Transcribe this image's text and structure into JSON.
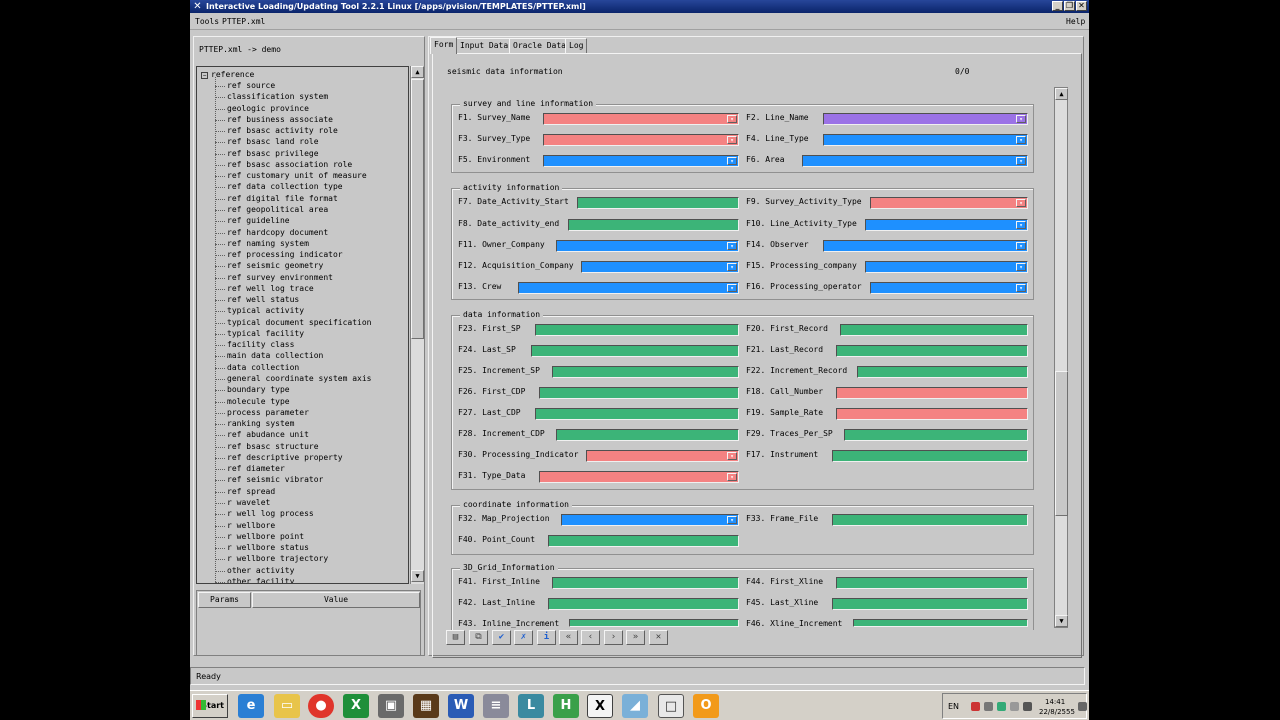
{
  "window": {
    "title": "Interactive Loading/Updating Tool 2.2.1 Linux [/apps/pvision/TEMPLATES/PTTEP.xml]",
    "minimize": "_",
    "restore": "❐",
    "close": "✕"
  },
  "menubar": {
    "tools": "Tools",
    "file": "PTTEP.xml",
    "help": "Help"
  },
  "left": {
    "path": "PTTEP.xml -> demo",
    "root": "reference",
    "items": [
      "ref source",
      "classification system",
      "geologic province",
      "ref business associate",
      "ref bsasc activity role",
      "ref bsasc land role",
      "ref bsasc privilege",
      "ref bsasc association role",
      "ref customary unit of measure",
      "ref data collection type",
      "ref digital file format",
      "ref geopolitical area",
      "ref guideline",
      "ref hardcopy document",
      "ref naming system",
      "ref processing indicator",
      "ref seismic geometry",
      "ref survey environment",
      "ref well log trace",
      "ref well status",
      "typical activity",
      "typical document specification",
      "typical facility",
      "facility class",
      "main data collection",
      "data collection",
      "general coordinate system axis",
      "boundary type",
      "molecule type",
      "process parameter",
      "ranking system",
      "ref abudance unit",
      "ref bsasc structure",
      "ref descriptive property",
      "ref diameter",
      "ref seismic vibrator",
      "ref spread",
      "r wavelet",
      "r well log process",
      "r wellbore",
      "r wellbore point",
      "r wellbore status",
      "r wellbore trajectory",
      "other activity",
      "other facility"
    ],
    "params_header": "Params",
    "value_header": "Value"
  },
  "tabs": [
    "Form",
    "Input Data",
    "Oracle Data",
    "Log"
  ],
  "form": {
    "heading": "seismic data information",
    "counter": "0/0",
    "groups": {
      "survey": "survey and line information",
      "activity": "activity information",
      "data": "data information",
      "coordinate": "coordinate information",
      "grid": "3D_Grid_Information"
    },
    "fields": {
      "f1": "F1. Survey_Name",
      "f2": "F2. Line_Name",
      "f3": "F3. Survey_Type",
      "f4": "F4. Line_Type",
      "f5": "F5. Environment",
      "f6": "F6. Area",
      "f7": "F7. Date_Activity_Start",
      "f9": "F9. Survey_Activity_Type",
      "f8": "F8. Date_activity_end",
      "f10": "F10. Line_Activity_Type",
      "f11": "F11. Owner_Company",
      "f14": "F14. Observer",
      "f12": "F12. Acquisition_Company",
      "f15": "F15. Processing_company",
      "f13": "F13. Crew",
      "f16": "F16. Processing_operator",
      "f23": "F23. First_SP",
      "f20": "F20. First_Record",
      "f24": "F24. Last_SP",
      "f21": "F21. Last_Record",
      "f25": "F25. Increment_SP",
      "f22": "F22. Increment_Record",
      "f26": "F26. First_CDP",
      "f18": "F18. Call_Number",
      "f27": "F27. Last_CDP",
      "f19": "F19. Sample_Rate",
      "f28": "F28. Increment_CDP",
      "f29": "F29. Traces_Per_SP",
      "f30": "F30. Processing_Indicator",
      "f17": "F17. Instrument",
      "f31": "F31. Type_Data",
      "f32": "F32. Map_Projection",
      "f33": "F33. Frame_File",
      "f40": "F40. Point_Count",
      "f41": "F41. First_Inline",
      "f44": "F44. First_Xline",
      "f42": "F42. Last_Inline",
      "f45": "F45. Last_Xline",
      "f43": "F43. Inline_Increment",
      "f46": "F46. Xline_Increment"
    },
    "field_colors": {
      "red": "#f48282",
      "green": "#3cb478",
      "blue": "#1e90ff",
      "purple": "#9b72e6"
    }
  },
  "toolbar": {
    "icons": [
      "new-document-icon",
      "copy-icon",
      "check-icon",
      "uncheck-icon",
      "info-icon",
      "first-icon",
      "prev-icon",
      "next-icon",
      "last-icon",
      "cancel-icon"
    ],
    "glyphs": [
      "▤",
      "⧉",
      "✔",
      "✗",
      "i",
      "«",
      "‹",
      "›",
      "»",
      "✕"
    ]
  },
  "status": "Ready",
  "taskbar": {
    "start": "Start",
    "lang": "EN",
    "time": "14:41",
    "date": "22/8/2555"
  }
}
